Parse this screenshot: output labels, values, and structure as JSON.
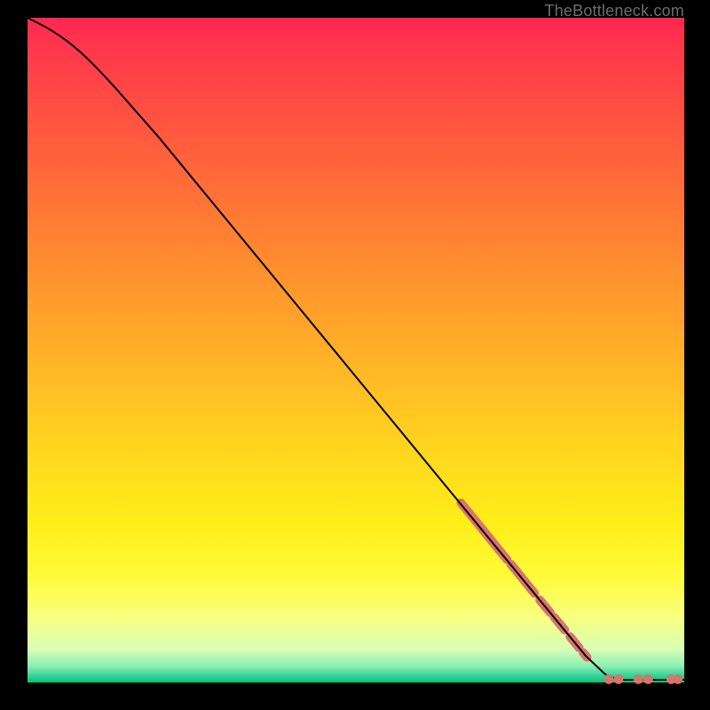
{
  "watermark": "TheBottleneck.com",
  "chart_data": {
    "type": "line",
    "title": "",
    "xlabel": "",
    "ylabel": "",
    "xlim": [
      0,
      100
    ],
    "ylim": [
      0,
      100
    ],
    "grid": false,
    "legend": false,
    "curve": {
      "name": "main-curve",
      "color": "#000000",
      "points": [
        {
          "x": 0,
          "y": 100
        },
        {
          "x": 4,
          "y": 98
        },
        {
          "x": 8,
          "y": 95
        },
        {
          "x": 12,
          "y": 91
        },
        {
          "x": 16,
          "y": 86.5
        },
        {
          "x": 20,
          "y": 82
        },
        {
          "x": 30,
          "y": 70
        },
        {
          "x": 40,
          "y": 58
        },
        {
          "x": 50,
          "y": 46
        },
        {
          "x": 60,
          "y": 34
        },
        {
          "x": 70,
          "y": 22
        },
        {
          "x": 80,
          "y": 10
        },
        {
          "x": 85,
          "y": 4
        },
        {
          "x": 88,
          "y": 1.2
        },
        {
          "x": 90,
          "y": 0.4
        },
        {
          "x": 100,
          "y": 0.4
        }
      ]
    },
    "highlight_strokes": {
      "name": "highlight-segments",
      "color": "#d8746d",
      "width": 10,
      "segments": [
        {
          "x1": 66,
          "y1": 27.0,
          "x2": 67,
          "y2": 25.8
        },
        {
          "x1": 67,
          "y1": 25.8,
          "x2": 72,
          "y2": 19.7
        },
        {
          "x1": 72,
          "y1": 19.7,
          "x2": 73,
          "y2": 18.5
        },
        {
          "x1": 73.6,
          "y1": 17.8,
          "x2": 77.2,
          "y2": 13.4
        },
        {
          "x1": 78.0,
          "y1": 12.4,
          "x2": 79.6,
          "y2": 10.5
        },
        {
          "x1": 80.2,
          "y1": 9.8,
          "x2": 81.8,
          "y2": 7.9
        },
        {
          "x1": 82.6,
          "y1": 6.9,
          "x2": 84.0,
          "y2": 5.2
        },
        {
          "x1": 84.6,
          "y1": 4.5,
          "x2": 85.2,
          "y2": 3.8
        }
      ]
    },
    "highlight_dots": {
      "name": "highlight-dots",
      "color": "#d8746d",
      "radius": 5.5,
      "points": [
        {
          "x": 88.5,
          "y": 0.5
        },
        {
          "x": 90.0,
          "y": 0.5
        },
        {
          "x": 93.0,
          "y": 0.5
        },
        {
          "x": 94.5,
          "y": 0.5
        },
        {
          "x": 98.0,
          "y": 0.5
        },
        {
          "x": 99.0,
          "y": 0.5
        }
      ]
    },
    "gradient_stops": [
      {
        "pos": 0,
        "color": "#ff2850"
      },
      {
        "pos": 0.5,
        "color": "#ffd81e"
      },
      {
        "pos": 0.9,
        "color": "#f8ff7e"
      },
      {
        "pos": 0.99,
        "color": "#34d399"
      },
      {
        "pos": 1.0,
        "color": "#0abf7a"
      }
    ]
  }
}
